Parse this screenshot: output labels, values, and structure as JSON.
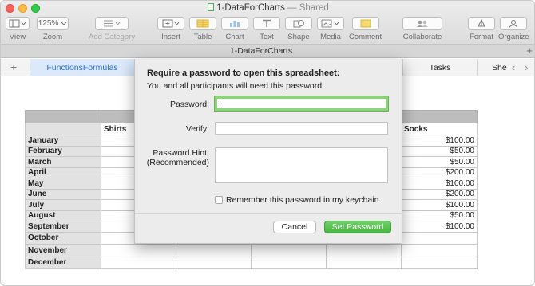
{
  "window": {
    "document_name": "1-DataForCharts",
    "title_separator": " — ",
    "title_suffix": "Shared"
  },
  "toolbar": {
    "view_label": "View",
    "zoom_value": "125%",
    "zoom_label": "Zoom",
    "add_category_label": "Add Category",
    "insert_label": "Insert",
    "table_label": "Table",
    "chart_label": "Chart",
    "text_label": "Text",
    "shape_label": "Shape",
    "media_label": "Media",
    "comment_label": "Comment",
    "collaborate_label": "Collaborate",
    "format_label": "Format",
    "organize_label": "Organize"
  },
  "tab_title": "1-DataForCharts",
  "sheets": {
    "active": "FunctionsFormulas",
    "tasks": "Tasks",
    "partial": "She"
  },
  "spreadsheet": {
    "col_b_header": "Shirts",
    "col_f_header": "Socks",
    "rows": [
      {
        "month": "January",
        "socks": "$100.00"
      },
      {
        "month": "February",
        "socks": "$50.00"
      },
      {
        "month": "March",
        "socks": "$50.00"
      },
      {
        "month": "April",
        "socks": "$200.00"
      },
      {
        "month": "May",
        "socks": "$100.00"
      },
      {
        "month": "June",
        "socks": "$200.00"
      },
      {
        "month": "July",
        "socks": "$100.00"
      },
      {
        "month": "August",
        "socks": "$50.00"
      },
      {
        "month": "September",
        "socks": "$100.00"
      },
      {
        "month": "October",
        "socks": ""
      },
      {
        "month": "November",
        "socks": ""
      },
      {
        "month": "December",
        "socks": ""
      }
    ]
  },
  "dialog": {
    "title": "Require a password to open this spreadsheet:",
    "subtitle": "You and all participants will need this password.",
    "password_label": "Password:",
    "password_value": "",
    "verify_label": "Verify:",
    "verify_value": "",
    "hint_label_line1": "Password Hint:",
    "hint_label_line2": "(Recommended)",
    "hint_value": "",
    "remember_label": "Remember this password in my keychain",
    "remember_checked": false,
    "cancel_label": "Cancel",
    "set_label": "Set Password"
  },
  "colors": {
    "accent_green": "#49b546",
    "focus_ring": "#8fd17c",
    "active_tab_text": "#2b6fd6"
  }
}
